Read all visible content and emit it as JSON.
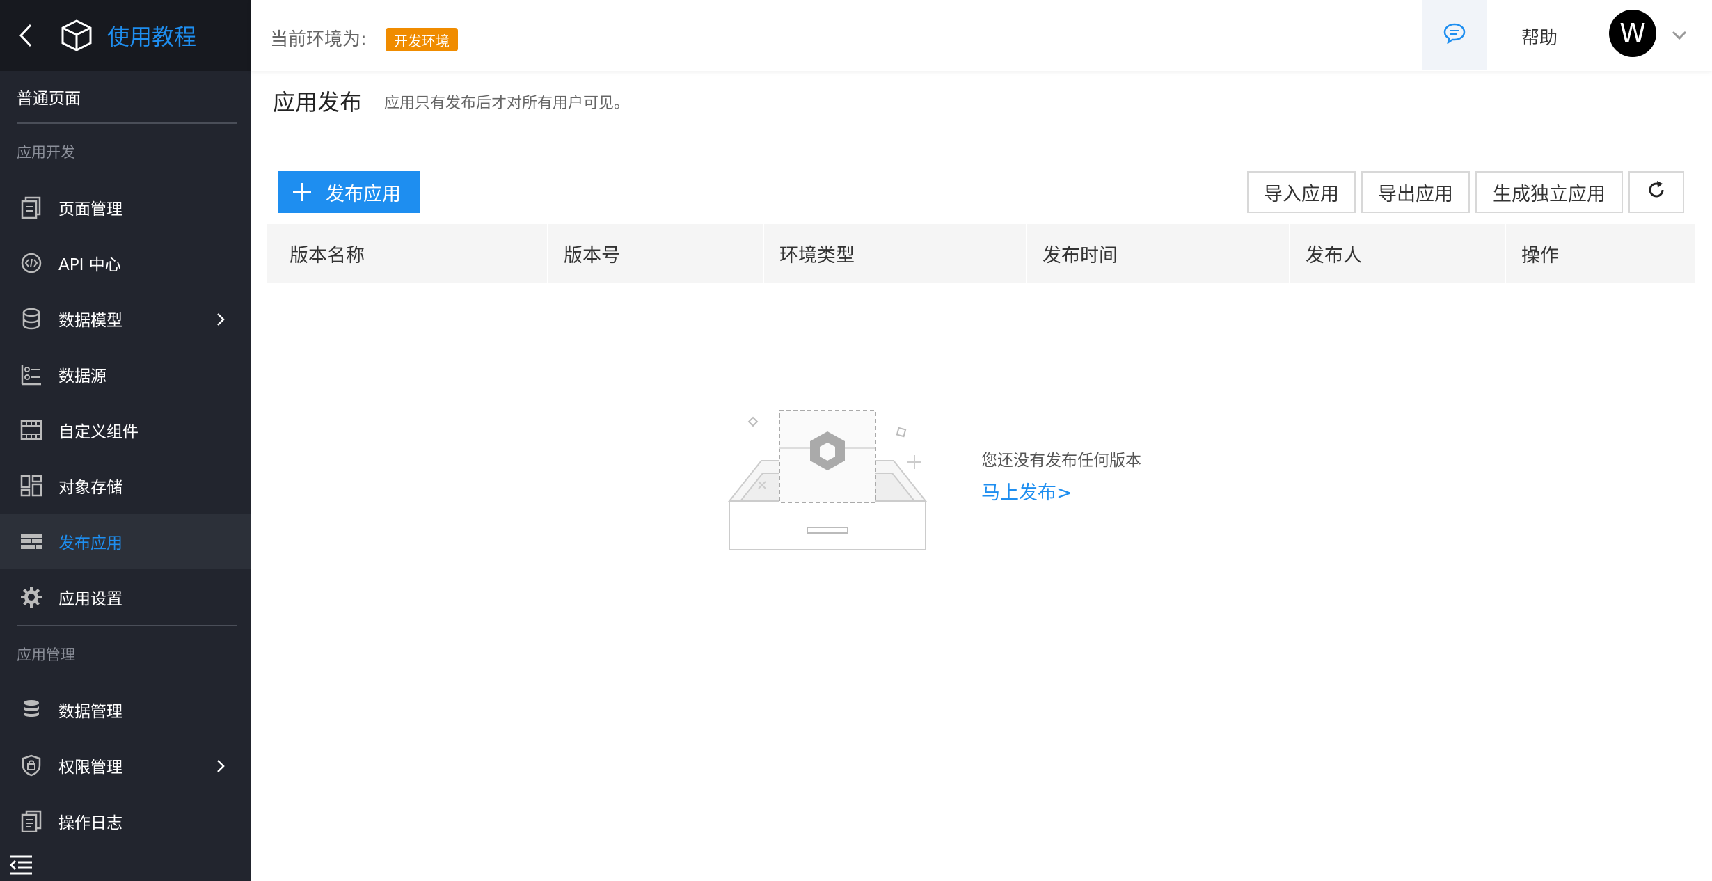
{
  "app": {
    "name": "使用教程",
    "accent": "#1e8ef0"
  },
  "sidebar": {
    "normal_page": "普通页面",
    "section_dev": "应用开发",
    "dev_items": [
      {
        "label": "页面管理",
        "icon": "page-manage-icon"
      },
      {
        "label": "API 中心",
        "icon": "api-icon"
      },
      {
        "label": "数据模型",
        "icon": "database-icon",
        "has_children": true
      },
      {
        "label": "数据源",
        "icon": "datasource-icon"
      },
      {
        "label": "自定义组件",
        "icon": "component-icon"
      },
      {
        "label": "对象存储",
        "icon": "storage-icon"
      },
      {
        "label": "发布应用",
        "icon": "publish-icon",
        "active": true
      },
      {
        "label": "应用设置",
        "icon": "gear-icon"
      }
    ],
    "section_manage": "应用管理",
    "manage_items": [
      {
        "label": "数据管理",
        "icon": "data-manage-icon"
      },
      {
        "label": "权限管理",
        "icon": "shield-icon",
        "has_children": true
      },
      {
        "label": "操作日志",
        "icon": "log-icon"
      }
    ]
  },
  "header": {
    "env_label": "当前环境为:",
    "env_badge": "开发环境",
    "env_badge_color": "#f08c00",
    "help": "帮助",
    "avatar_letter": "W"
  },
  "page": {
    "title": "应用发布",
    "subtitle": "应用只有发布后才对所有用户可见。"
  },
  "toolbar": {
    "publish": "发布应用",
    "import": "导入应用",
    "export": "导出应用",
    "standalone": "生成独立应用"
  },
  "table": {
    "columns": [
      "版本名称",
      "版本号",
      "环境类型",
      "发布时间",
      "发布人",
      "操作"
    ],
    "rows": []
  },
  "empty": {
    "message": "您还没有发布任何版本",
    "action": "马上发布>"
  }
}
